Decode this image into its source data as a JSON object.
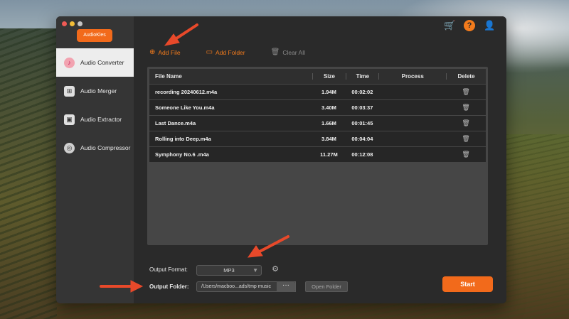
{
  "app": {
    "logo": "AudioKles"
  },
  "sidebar": {
    "items": [
      {
        "label": "Audio Converter",
        "active": true
      },
      {
        "label": "Audio Merger"
      },
      {
        "label": "Audio Extractor"
      },
      {
        "label": "Audio Compressor"
      }
    ]
  },
  "topbar": {
    "icons": [
      "cart-icon",
      "help-icon",
      "account-icon"
    ]
  },
  "toolbar": {
    "add_file": "Add File",
    "add_folder": "Add Folder",
    "clear_all": "Clear All"
  },
  "table": {
    "headers": {
      "name": "File Name",
      "size": "Size",
      "time": "Time",
      "process": "Process",
      "delete": "Delete"
    },
    "rows": [
      {
        "name": "recording 20240612.m4a",
        "size": "1.94M",
        "time": "00:02:02"
      },
      {
        "name": "Someone Like You.m4a",
        "size": "3.40M",
        "time": "00:03:37"
      },
      {
        "name": "Last Dance.m4a",
        "size": "1.66M",
        "time": "00:01:45"
      },
      {
        "name": "Rolling into Deep.m4a",
        "size": "3.84M",
        "time": "00:04:04"
      },
      {
        "name": "Symphony No.6 .m4a",
        "size": "11.27M",
        "time": "00:12:08"
      }
    ]
  },
  "output": {
    "format_label": "Output Format:",
    "format_value": "MP3",
    "folder_label": "Output Folder:",
    "folder_path": "/Users/macboo...ads/tmp music",
    "browse": "···",
    "open_folder": "Open Folder",
    "start": "Start"
  },
  "colors": {
    "accent": "#f26a1b",
    "arrow": "#e8492a"
  }
}
